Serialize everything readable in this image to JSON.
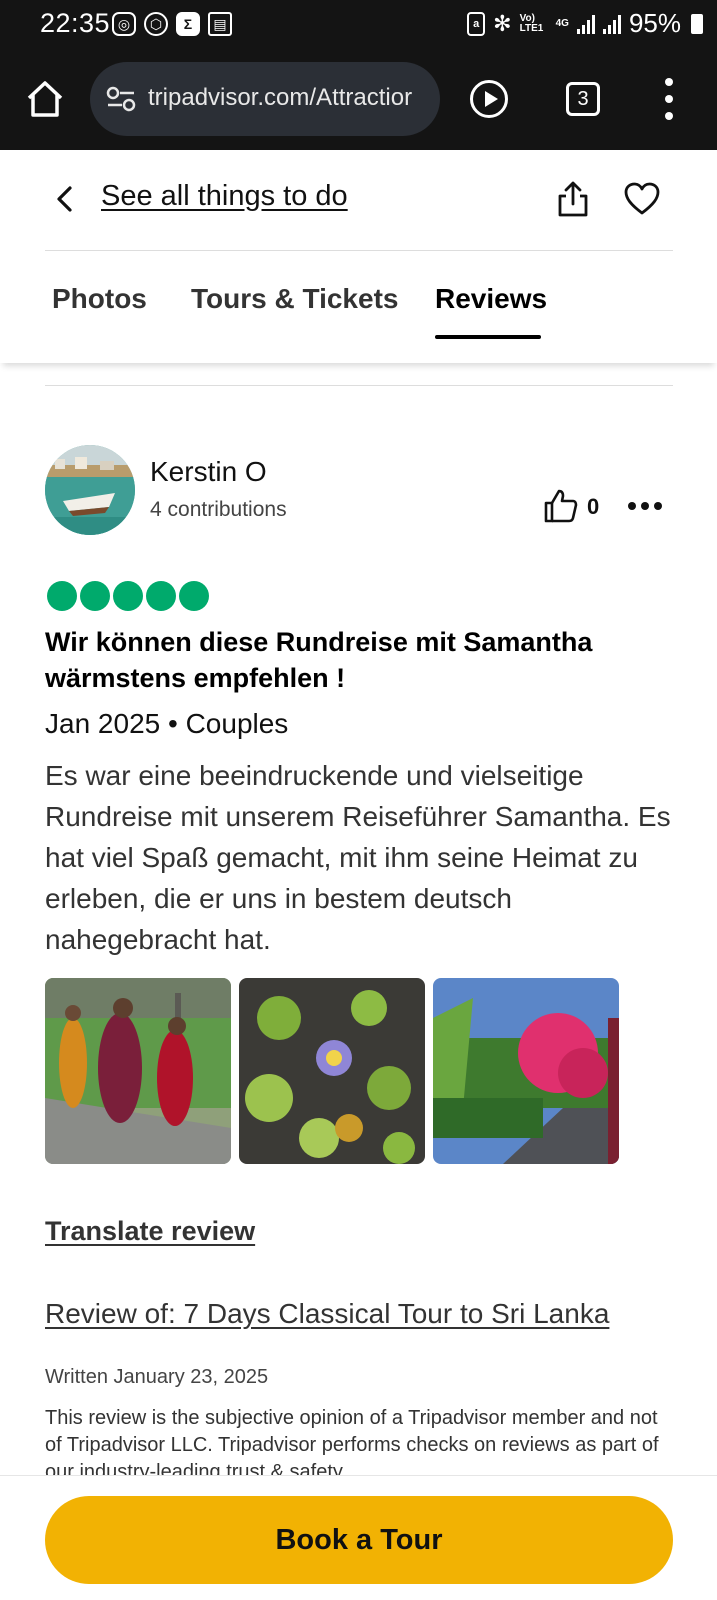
{
  "status_bar": {
    "time": "22:35",
    "battery": "95%",
    "volte": "Vo) LTE1",
    "network": "4G"
  },
  "browser": {
    "url": "tripadvisor.com/Attractior",
    "tab_count": "3"
  },
  "nav": {
    "back_label": "See all things to do"
  },
  "tabs": [
    {
      "label": "Photos",
      "active": false
    },
    {
      "label": "Tours & Tickets",
      "active": false
    },
    {
      "label": "Reviews",
      "active": true
    }
  ],
  "review": {
    "reviewer_name": "Kerstin O",
    "contributions": "4 contributions",
    "helpful_count": "0",
    "rating": 5,
    "title": "Wir können diese Rundreise mit Samantha wärmstens empfehlen !",
    "meta": "Jan 2025 • Couples",
    "body": "Es war eine beeindruckende und vielseitige Rundreise mit unserem Reiseführer Samantha. Es hat viel Spaß gemacht, mit ihm seine Heimat zu erleben, die er uns in bestem deutsch nahegebracht hat.",
    "translate_label": "Translate review",
    "review_of": "Review of: 7 Days Classical Tour to Sri Lanka",
    "written": "Written January 23, 2025",
    "disclaimer": "This review is the subjective opinion of a Tripadvisor member and not of Tripadvisor LLC. Tripadvisor performs checks on reviews as part of our industry-leading trust & safety"
  },
  "cta": {
    "label": "Book a Tour"
  },
  "colors": {
    "rating_green": "#00aa6c",
    "cta_yellow": "#f2b203",
    "status_bg": "#141414"
  }
}
